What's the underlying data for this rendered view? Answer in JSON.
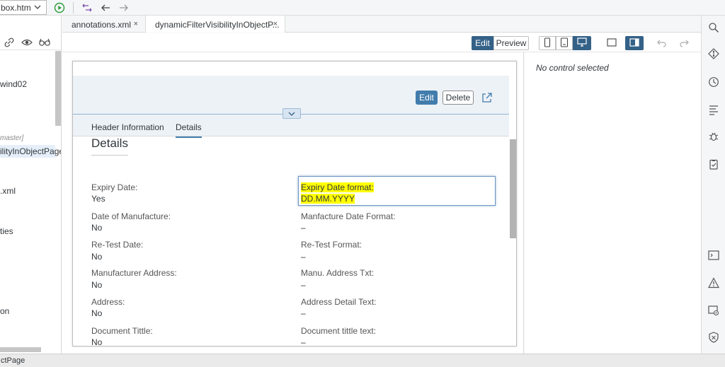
{
  "toolbar": {
    "file_name": "box.htm",
    "icons": [
      "dropdown-chevron-icon",
      "run-icon",
      "transfer-icon",
      "back-arrow-icon",
      "forward-arrow-icon"
    ]
  },
  "explorer": {
    "tools": [
      "link-icon",
      "eye-icon",
      "glasses-icon"
    ],
    "items": [
      {
        "label": "wind02"
      },
      {
        "label": "master]"
      },
      {
        "label": "ilityInObjectPage"
      },
      {
        "label": ".xml"
      },
      {
        "label": "ties"
      },
      {
        "label": "on"
      }
    ]
  },
  "tabs": [
    {
      "label": "annotations.xml",
      "close": "×"
    },
    {
      "label": "dynamicFilterVisibilityInObjectP...",
      "close": "×"
    }
  ],
  "preview_bar": {
    "edit_label": "Edit",
    "preview_label": "Preview"
  },
  "object_page": {
    "edit_button": "Edit",
    "delete_button": "Delete",
    "anchors": [
      "Header Information",
      "Details"
    ],
    "section_title": "Details",
    "fields": [
      {
        "label": "Expiry Date:",
        "value": "Yes",
        "right_label": "Expiry Date format:",
        "right_value": "DD.MM.YYYY"
      },
      {
        "label": "Date of Manufacture:",
        "value": "No",
        "right_label": "Manfacture Date Format:",
        "right_value": "–"
      },
      {
        "label": "Re-Test Date:",
        "value": "No",
        "right_label": "Re-Test Format:",
        "right_value": "–"
      },
      {
        "label": "Manufacturer Address:",
        "value": "No",
        "right_label": "Manu. Address Txt:",
        "right_value": "–"
      },
      {
        "label": "Address:",
        "value": "No",
        "right_label": "Address Detail Text:",
        "right_value": "–"
      },
      {
        "label": "Document Tittle:",
        "value": "No",
        "right_label": "Document tittle text:",
        "right_value": "–"
      }
    ]
  },
  "properties": {
    "empty_text": "No control selected"
  },
  "rail_icons": [
    "search-icon",
    "git-icon",
    "history-icon",
    "outline-icon",
    "debug-icon",
    "clipboard-check-icon",
    "terminal-icon",
    "warning-icon",
    "image-settings-icon",
    "shield-icon"
  ],
  "statusbar": {
    "text": "ctPage"
  },
  "colors": {
    "accent": "#346187",
    "button_emphasized": "#427cac",
    "highlight": "#ffff00",
    "header_bg": "#edf2f7"
  }
}
